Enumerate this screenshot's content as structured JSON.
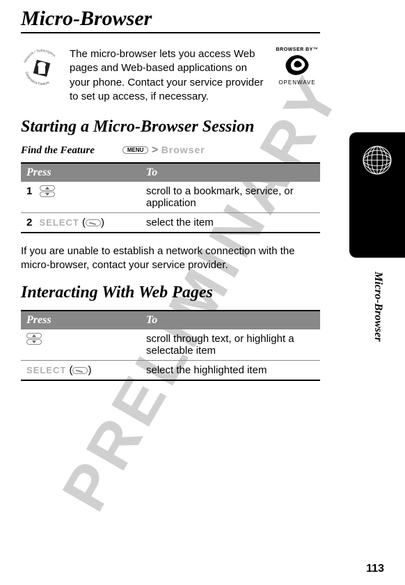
{
  "watermark": "PRELIMINARY",
  "page_title": "Micro-Browser",
  "intro_text": "The micro-browser lets you access Web pages and Web-based applications on your phone. Contact your service provider to set up access, if necessary.",
  "browser_by": {
    "label": "BROWSER BY",
    "tm": "™",
    "brand": "OPENWAVE"
  },
  "section1": {
    "heading": "Starting a Micro-Browser Session",
    "find_feature": "Find the Feature",
    "menu_label": "MENU",
    "gt": ">",
    "browser_soft": "Browser",
    "table": {
      "headers": {
        "press": "Press",
        "to": "To"
      },
      "rows": [
        {
          "step": "1",
          "press_icon": "scroll",
          "to": "scroll to a bookmark, service, or application"
        },
        {
          "step": "2",
          "press_label": "SELECT",
          "press_paren_open": "(",
          "press_paren_close": ")",
          "to": "select the item"
        }
      ]
    },
    "after_para": "If you are unable to establish a network connection with the micro-browser, contact your service provider."
  },
  "section2": {
    "heading": "Interacting With Web Pages",
    "table": {
      "headers": {
        "press": "Press",
        "to": "To"
      },
      "rows": [
        {
          "press_icon": "scroll",
          "to": "scroll through text, or highlight a selectable item"
        },
        {
          "press_label": "SELECT",
          "press_paren_open": "(",
          "press_paren_close": ")",
          "to": "select the highlighted item"
        }
      ]
    }
  },
  "side_label": "Micro-Browser",
  "page_number": "113",
  "feature_icon_text": {
    "top": "Network / Subscription",
    "bottom": "Dependent Feature"
  }
}
